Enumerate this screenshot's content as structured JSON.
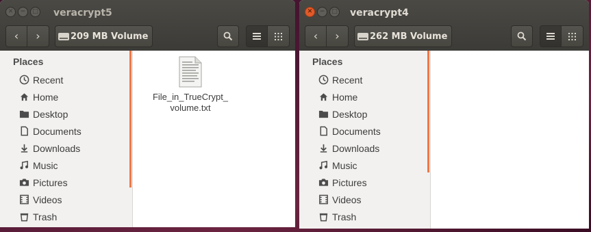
{
  "windows": [
    {
      "title": "veracrypt5",
      "location": "209 MB Volume",
      "sidebar": {
        "header": "Places",
        "items": [
          {
            "label": "Recent",
            "icon": "recent-icon"
          },
          {
            "label": "Home",
            "icon": "home-icon"
          },
          {
            "label": "Desktop",
            "icon": "desktop-icon"
          },
          {
            "label": "Documents",
            "icon": "documents-icon"
          },
          {
            "label": "Downloads",
            "icon": "downloads-icon"
          },
          {
            "label": "Music",
            "icon": "music-icon"
          },
          {
            "label": "Pictures",
            "icon": "pictures-icon"
          },
          {
            "label": "Videos",
            "icon": "videos-icon"
          },
          {
            "label": "Trash",
            "icon": "trash-icon"
          }
        ]
      },
      "files": [
        {
          "name_line1": "File_in_TrueCrypt_",
          "name_line2": "volume.txt",
          "icon": "text-file-icon"
        }
      ]
    },
    {
      "title": "veracrypt4",
      "location": "262 MB Volume",
      "sidebar": {
        "header": "Places",
        "items": [
          {
            "label": "Recent",
            "icon": "recent-icon"
          },
          {
            "label": "Home",
            "icon": "home-icon"
          },
          {
            "label": "Desktop",
            "icon": "desktop-icon"
          },
          {
            "label": "Documents",
            "icon": "documents-icon"
          },
          {
            "label": "Downloads",
            "icon": "downloads-icon"
          },
          {
            "label": "Music",
            "icon": "music-icon"
          },
          {
            "label": "Pictures",
            "icon": "pictures-icon"
          },
          {
            "label": "Videos",
            "icon": "videos-icon"
          },
          {
            "label": "Trash",
            "icon": "trash-icon"
          }
        ]
      },
      "files": []
    }
  ],
  "colors": {
    "titlebar": "#3c3b37",
    "close_active": "#e25a28",
    "sidebar_bg": "#f2f1ef",
    "scroll_accent": "#f07746",
    "desktop_bg": "#4a1632"
  }
}
